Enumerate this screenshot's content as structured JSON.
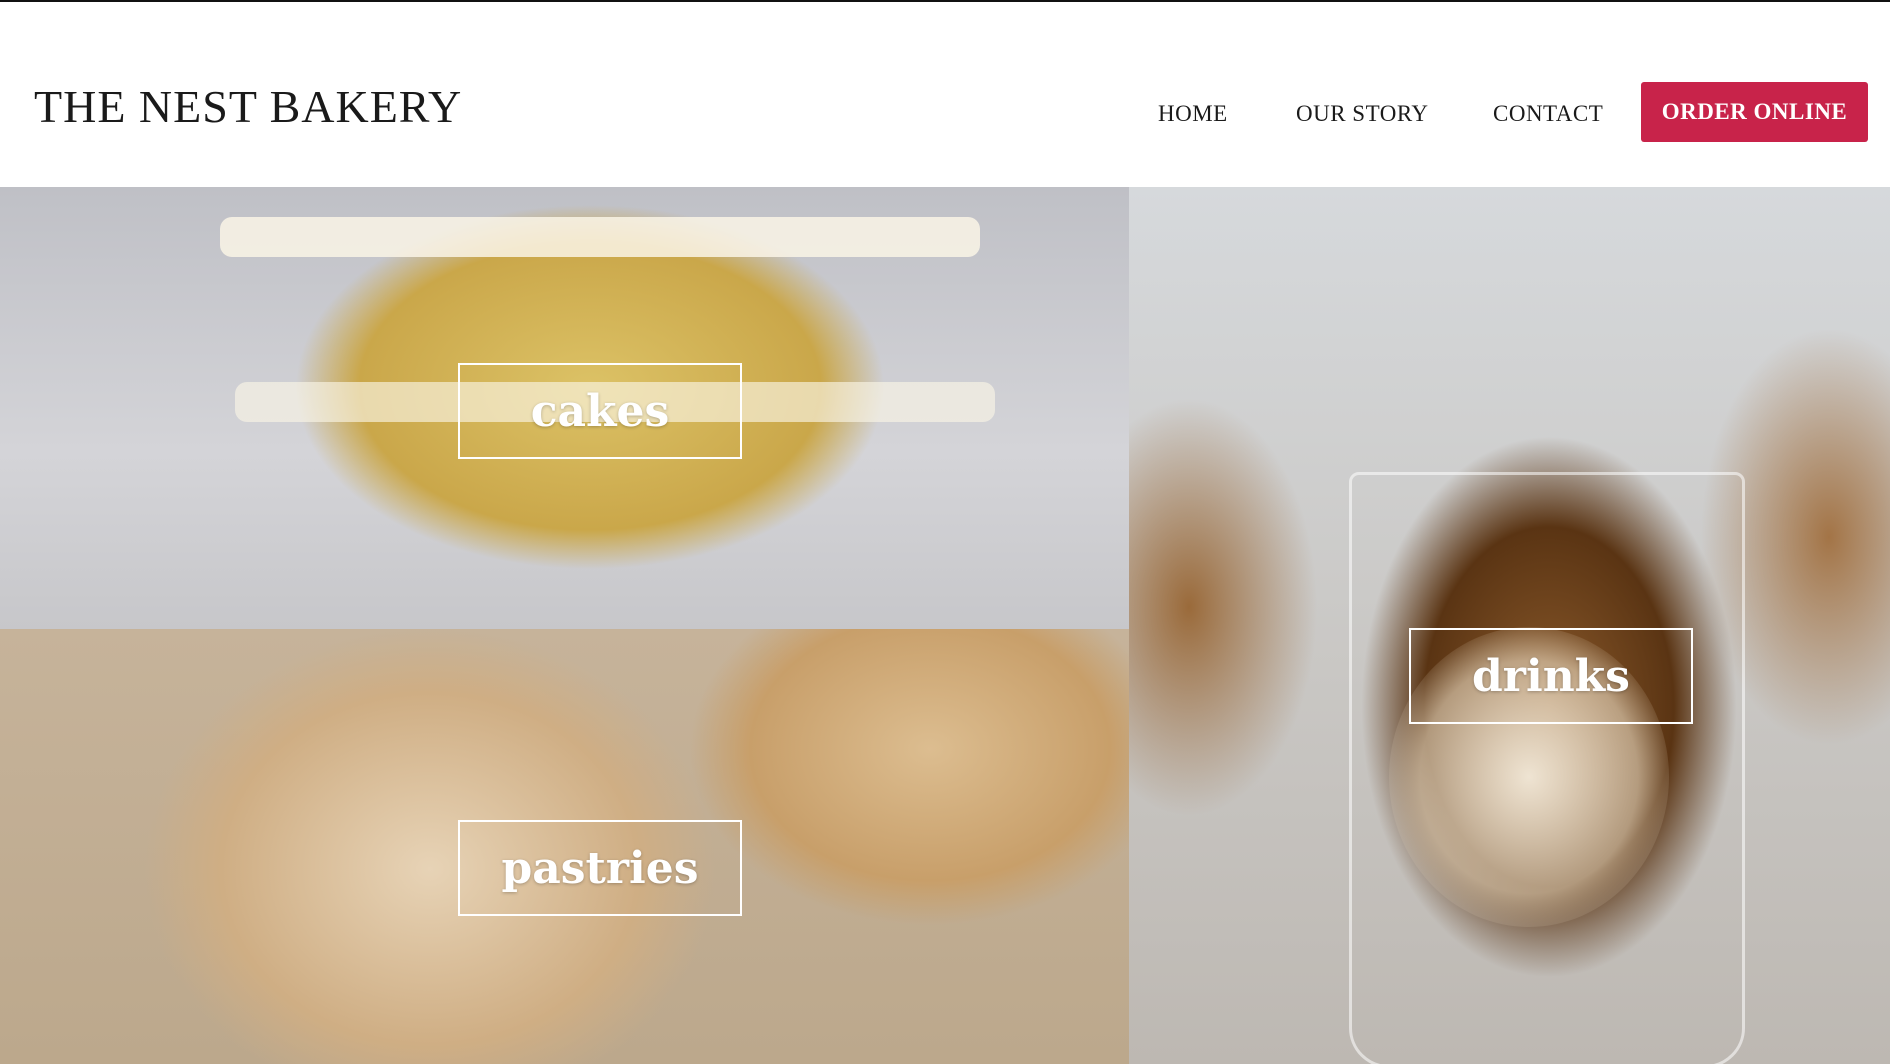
{
  "header": {
    "brand": "THE NEST BAKERY",
    "nav": {
      "home": "HOME",
      "our_story": "OUR STORY",
      "contact": "CONTACT"
    },
    "order_button": "ORDER ONLINE"
  },
  "categories": {
    "cakes": "cakes",
    "pastries": "pastries",
    "drinks": "drinks"
  },
  "colors": {
    "accent": "#c8234a",
    "text": "#1a1a1a",
    "background": "#ffffff"
  }
}
